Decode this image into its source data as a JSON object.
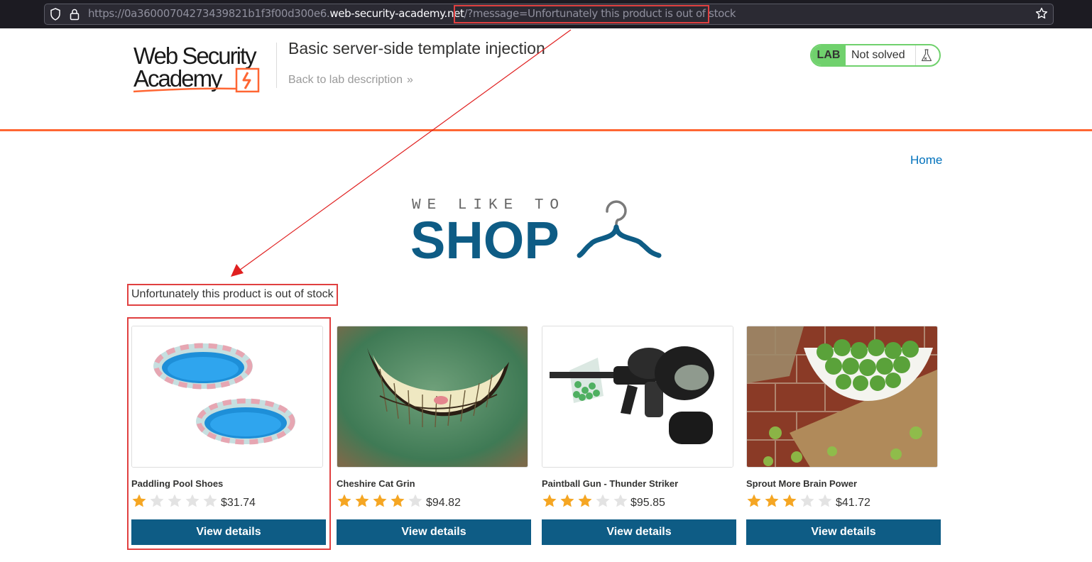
{
  "browser": {
    "url_prefix": "https://0a36000704273439821b1f3f00d300e6.",
    "url_domain": "web-security-academy.net",
    "url_slash": "/",
    "url_query": "?message=Unfortunately this product is out of stock"
  },
  "header": {
    "logo_line1": "Web Security",
    "logo_line2": "Academy",
    "lab_title": "Basic server-side template injection",
    "back_link": "Back to lab description",
    "status_badge": "LAB",
    "status_text": "Not solved"
  },
  "nav": {
    "home": "Home"
  },
  "shop_logo": {
    "line1": "WE LIKE TO",
    "line2": "SHOP"
  },
  "message": "Unfortunately this product is out of stock",
  "products": [
    {
      "name": "Paddling Pool Shoes",
      "rating": 1,
      "price": "$31.74",
      "button": "View details"
    },
    {
      "name": "Cheshire Cat Grin",
      "rating": 4,
      "price": "$94.82",
      "button": "View details"
    },
    {
      "name": "Paintball Gun - Thunder Striker",
      "rating": 3,
      "price": "$95.85",
      "button": "View details"
    },
    {
      "name": "Sprout More Brain Power",
      "rating": 3,
      "price": "$41.72",
      "button": "View details"
    }
  ],
  "colors": {
    "accent_orange": "#ff6633",
    "button_blue": "#0e5c85",
    "star_gold": "#f5a623",
    "star_empty": "#e3e3e3",
    "lab_green": "#70d16d",
    "annotation_red": "#e04040"
  }
}
